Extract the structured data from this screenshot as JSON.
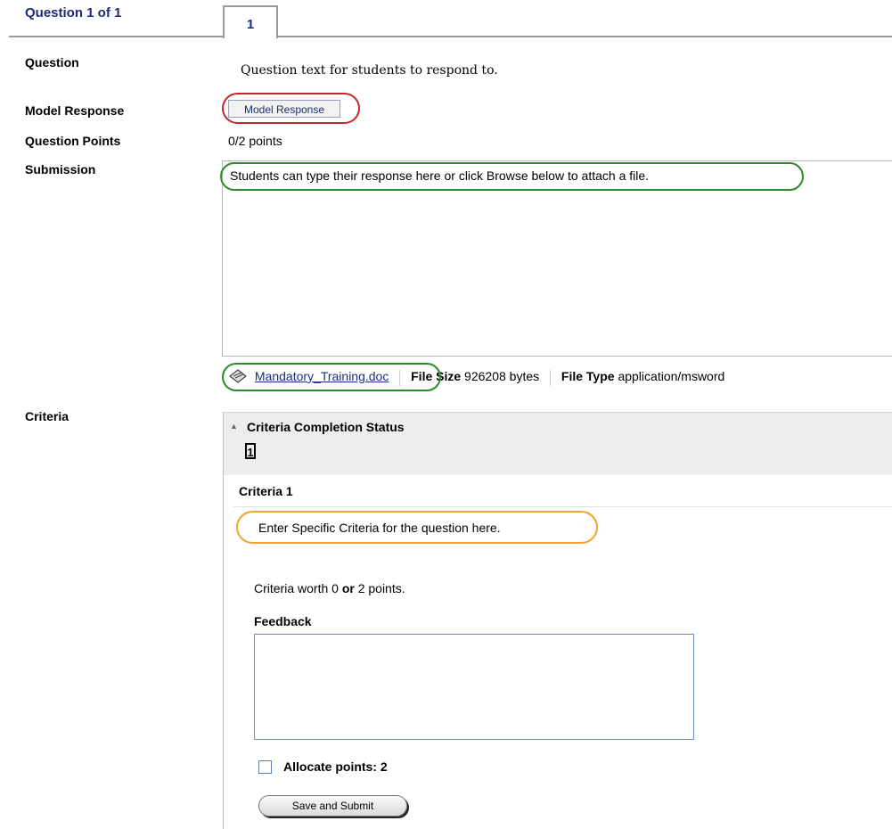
{
  "header": {
    "title": "Question 1 of 1",
    "tab": "1"
  },
  "labels": {
    "question": "Question",
    "model_response": "Model Response",
    "question_points": "Question Points",
    "submission": "Submission",
    "criteria": "Criteria"
  },
  "question_text": "Question text for students to respond to.",
  "model_response_button": "Model Response",
  "points": "0/2 points",
  "submission": {
    "text": "Students can type their response here or click Browse below to attach a file.",
    "file_name": "Mandatory_Training.doc",
    "file_size_label": "File Size",
    "file_size": "926208 bytes",
    "file_type_label": "File Type",
    "file_type": "application/msword"
  },
  "criteria_panel": {
    "title": "Criteria Completion Status",
    "number": "1",
    "criteria_title": "Criteria 1",
    "specific": "Enter Specific Criteria for the question here.",
    "worth_prefix": "Criteria worth 0",
    "worth_or": "or",
    "worth_suffix": "2 points.",
    "feedback_label": "Feedback",
    "allocate_label": "Allocate points: 2",
    "save_button": "Save and Submit"
  },
  "colors": {
    "header_text": "#1f2a7a",
    "red_highlight": "#c0282b",
    "green_highlight": "#2c8a2c",
    "orange_highlight": "#f0a430",
    "link": "#1c2c8a"
  }
}
